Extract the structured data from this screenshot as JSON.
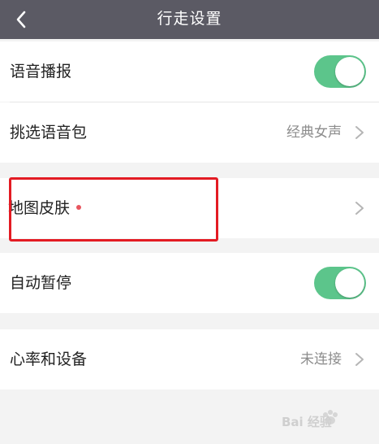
{
  "header": {
    "title": "行走设置",
    "back_icon": "chevron-left-icon"
  },
  "rows": [
    {
      "label": "语音播报",
      "control": "toggle",
      "toggle_on": true
    },
    {
      "label": "挑选语音包",
      "value": "经典女声",
      "control": "chevron"
    },
    {
      "label": "地图皮肤",
      "control": "chevron",
      "has_new_dot": true
    },
    {
      "label": "自动暂停",
      "control": "toggle",
      "toggle_on": true
    },
    {
      "label": "心率和设备",
      "value": "未连接",
      "control": "chevron"
    }
  ],
  "colors": {
    "header_bg": "#5b5a64",
    "toggle_on": "#5cc58b",
    "new_dot": "#e8555f",
    "highlight_box": "#e31b23",
    "page_bg": "#f3f3f3"
  },
  "watermark": {
    "text": "Bai 经验"
  }
}
